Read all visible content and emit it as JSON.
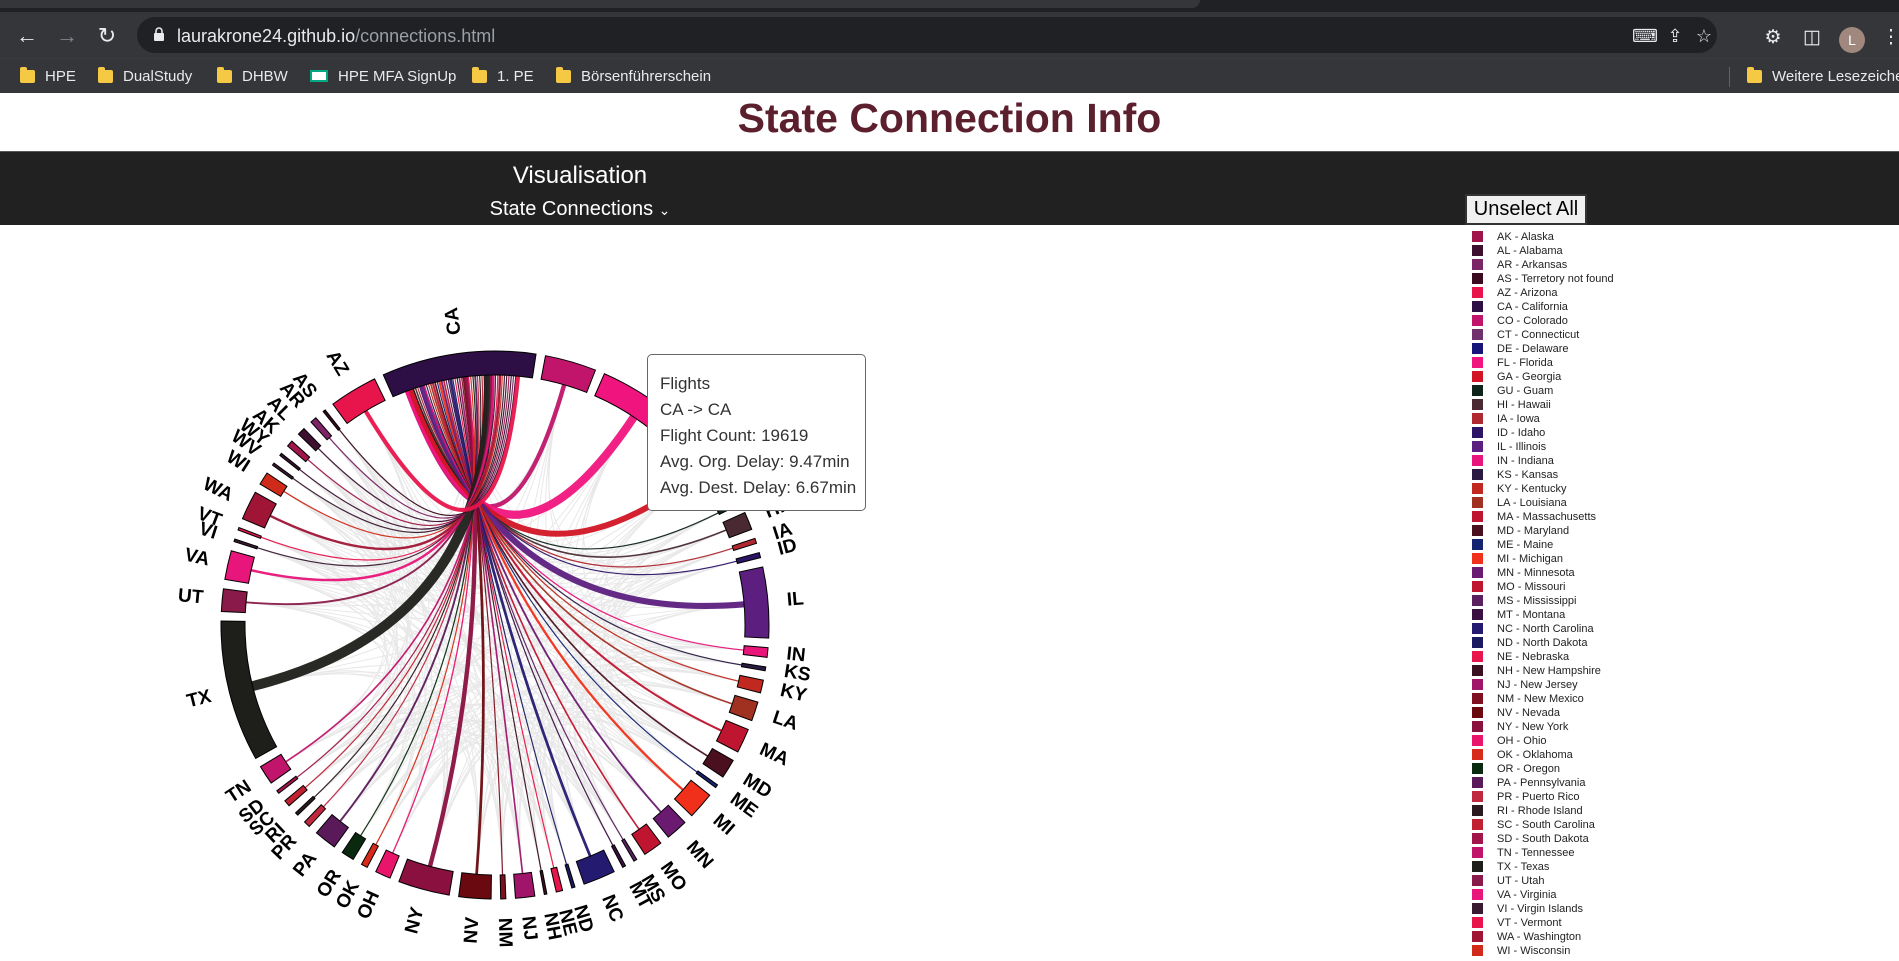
{
  "browser": {
    "url_host": "laurakrone24.github.io",
    "url_path": "/connections.html",
    "avatar_letter": "L",
    "bookmarks": [
      {
        "label": "HPE",
        "icon": "folder-icon"
      },
      {
        "label": "DualStudy",
        "icon": "folder-icon"
      },
      {
        "label": "DHBW",
        "icon": "folder-icon"
      },
      {
        "label": "HPE MFA SignUp",
        "icon": "hpe-icon"
      },
      {
        "label": "1. PE",
        "icon": "folder-icon"
      },
      {
        "label": "Börsenführerschein",
        "icon": "folder-icon"
      }
    ],
    "other_bookmarks": "Weitere Lesezeiche"
  },
  "page": {
    "title": "State Connection Info",
    "nav_title": "Visualisation",
    "nav_select": "State Connections",
    "unselect_all": "Unselect All"
  },
  "tooltip": {
    "title": "Flights",
    "route": "CA -> CA",
    "count": "Flight Count: 19619",
    "org_delay": "Avg. Org. Delay: 9.47min",
    "dest_delay": "Avg. Dest. Delay: 6.67min"
  },
  "legend": [
    {
      "label": "AK - Alaska",
      "color": "#a0154a"
    },
    {
      "label": "AL - Alabama",
      "color": "#3d1030"
    },
    {
      "label": "AR - Arkansas",
      "color": "#7b2466"
    },
    {
      "label": "AS - Terretory not found",
      "color": "#3a0a20"
    },
    {
      "label": "AZ - Arizona",
      "color": "#e8154c"
    },
    {
      "label": "CA - California",
      "color": "#2d0e45"
    },
    {
      "label": "CO - Colorado",
      "color": "#c0156a"
    },
    {
      "label": "CT - Connecticut",
      "color": "#70306c"
    },
    {
      "label": "DE - Delaware",
      "color": "#18157a"
    },
    {
      "label": "FL - Florida",
      "color": "#f0157e"
    },
    {
      "label": "GA - Georgia",
      "color": "#d11525"
    },
    {
      "label": "GU - Guam",
      "color": "#0f241a"
    },
    {
      "label": "HI - Hawaii",
      "color": "#4a2a32"
    },
    {
      "label": "IA - Iowa",
      "color": "#b02830"
    },
    {
      "label": "ID - Idaho",
      "color": "#2c1466"
    },
    {
      "label": "IL - Illinois",
      "color": "#5c1f80"
    },
    {
      "label": "IN - Indiana",
      "color": "#e8157a"
    },
    {
      "label": "KS - Kansas",
      "color": "#2a1a40"
    },
    {
      "label": "KY - Kentucky",
      "color": "#c02820"
    },
    {
      "label": "LA - Louisiana",
      "color": "#a03020"
    },
    {
      "label": "MA - Massachusetts",
      "color": "#c01530"
    },
    {
      "label": "MD - Maryland",
      "color": "#4a1020"
    },
    {
      "label": "ME - Maine",
      "color": "#142470"
    },
    {
      "label": "MI - Michigan",
      "color": "#f0301a"
    },
    {
      "label": "MN - Minnesota",
      "color": "#6a1a70"
    },
    {
      "label": "MO - Missouri",
      "color": "#c01530"
    },
    {
      "label": "MS - Mississippi",
      "color": "#5a2060"
    },
    {
      "label": "MT - Montana",
      "color": "#3a1040"
    },
    {
      "label": "NC - North Carolina",
      "color": "#241a70"
    },
    {
      "label": "ND - North Dakota",
      "color": "#1a1a60"
    },
    {
      "label": "NE - Nebraska",
      "color": "#e8154c"
    },
    {
      "label": "NH - New Hampshire",
      "color": "#3a1020"
    },
    {
      "label": "NJ - New Jersey",
      "color": "#a0156a"
    },
    {
      "label": "NM - New Mexico",
      "color": "#801020"
    },
    {
      "label": "NV - Nevada",
      "color": "#6a0a10"
    },
    {
      "label": "NY - New York",
      "color": "#8a1040"
    },
    {
      "label": "OH - Ohio",
      "color": "#e8156a"
    },
    {
      "label": "OK - Oklahoma",
      "color": "#d82a1a"
    },
    {
      "label": "OR - Oregon",
      "color": "#0a2a10"
    },
    {
      "label": "PA - Pennsylvania",
      "color": "#5a1a5a"
    },
    {
      "label": "PR - Puerto Rico",
      "color": "#c02840"
    },
    {
      "label": "RI - Rhode Island",
      "color": "#2a1a20"
    },
    {
      "label": "SC - South Carolina",
      "color": "#c02030"
    },
    {
      "label": "SD - South Dakota",
      "color": "#a0154a"
    },
    {
      "label": "TN - Tennessee",
      "color": "#c0156a"
    },
    {
      "label": "TX - Texas",
      "color": "#1e1f1a"
    },
    {
      "label": "UT - Utah",
      "color": "#8a1a4a"
    },
    {
      "label": "VA - Virginia",
      "color": "#e8157a"
    },
    {
      "label": "VI - Virgin Islands",
      "color": "#3a1a30"
    },
    {
      "label": "VT - Vermont",
      "color": "#e8154c"
    },
    {
      "label": "WA - Washington",
      "color": "#a01535"
    },
    {
      "label": "WI - Wisconsin",
      "color": "#d02a1a"
    }
  ],
  "chord": {
    "highlight_state": "CA",
    "states": [
      {
        "code": "CA",
        "label": "CA",
        "weight": 24,
        "color": "#2d0e45"
      },
      {
        "code": "CO",
        "label": "",
        "weight": 8,
        "color": "#c0156a"
      },
      {
        "code": "FL",
        "label": "FL",
        "weight": 15,
        "color": "#f0157e"
      },
      {
        "code": "GA",
        "label": "GA",
        "weight": 11,
        "color": "#d11525"
      },
      {
        "code": "GU",
        "label": "GU",
        "weight": 0.6,
        "color": "#0f241a"
      },
      {
        "code": "HI",
        "label": "HI",
        "weight": 2.8,
        "color": "#4a2a32"
      },
      {
        "code": "IA",
        "label": "IA",
        "weight": 0.8,
        "color": "#b02830"
      },
      {
        "code": "ID",
        "label": "ID",
        "weight": 0.8,
        "color": "#2c1466"
      },
      {
        "code": "IL",
        "label": "IL",
        "weight": 11,
        "color": "#5c1f80"
      },
      {
        "code": "IN",
        "label": "IN",
        "weight": 1.5,
        "color": "#e8157a"
      },
      {
        "code": "KS",
        "label": "KS",
        "weight": 0.6,
        "color": "#2a1a40"
      },
      {
        "code": "KY",
        "label": "KY",
        "weight": 2,
        "color": "#c02820"
      },
      {
        "code": "LA",
        "label": "LA",
        "weight": 3,
        "color": "#a03020"
      },
      {
        "code": "MA",
        "label": "MA",
        "weight": 3.8,
        "color": "#c01530"
      },
      {
        "code": "MD",
        "label": "MD",
        "weight": 3,
        "color": "#4a1020"
      },
      {
        "code": "ME",
        "label": "ME",
        "weight": 0.5,
        "color": "#142470"
      },
      {
        "code": "MI",
        "label": "MI",
        "weight": 4.2,
        "color": "#f0301a"
      },
      {
        "code": "MN",
        "label": "MN",
        "weight": 3.4,
        "color": "#6a1a70"
      },
      {
        "code": "MO",
        "label": "MO",
        "weight": 3,
        "color": "#c01530"
      },
      {
        "code": "MS",
        "label": "MS",
        "weight": 0.5,
        "color": "#5a2060"
      },
      {
        "code": "MT",
        "label": "MT",
        "weight": 0.5,
        "color": "#3a1040"
      },
      {
        "code": "NC",
        "label": "NC",
        "weight": 5,
        "color": "#241a70"
      },
      {
        "code": "ND",
        "label": "ND",
        "weight": 0.5,
        "color": "#1a1a60"
      },
      {
        "code": "NE",
        "label": "NE",
        "weight": 1,
        "color": "#e8154c"
      },
      {
        "code": "NH",
        "label": "NH",
        "weight": 0.4,
        "color": "#3a1020"
      },
      {
        "code": "NJ",
        "label": "NJ",
        "weight": 3,
        "color": "#a0156a"
      },
      {
        "code": "NM",
        "label": "NM",
        "weight": 0.8,
        "color": "#801020"
      },
      {
        "code": "NV",
        "label": "NV",
        "weight": 5,
        "color": "#6a0a10"
      },
      {
        "code": "NY",
        "label": "NY",
        "weight": 8,
        "color": "#8a1040"
      },
      {
        "code": "OH",
        "label": "OH",
        "weight": 2.4,
        "color": "#e8156a"
      },
      {
        "code": "OK",
        "label": "OK",
        "weight": 1,
        "color": "#d82a1a"
      },
      {
        "code": "OR",
        "label": "OR",
        "weight": 2,
        "color": "#0a2a10"
      },
      {
        "code": "PA",
        "label": "PA",
        "weight": 3.5,
        "color": "#5a1a5a"
      },
      {
        "code": "PR",
        "label": "PR",
        "weight": 1,
        "color": "#c02840"
      },
      {
        "code": "RI",
        "label": "RI",
        "weight": 0.5,
        "color": "#2a1a20"
      },
      {
        "code": "SC",
        "label": "SC",
        "weight": 1,
        "color": "#c02030"
      },
      {
        "code": "SD",
        "label": "SD",
        "weight": 0.5,
        "color": "#a0154a"
      },
      {
        "code": "TN",
        "label": "TN",
        "weight": 3,
        "color": "#c0156a"
      },
      {
        "code": "TX",
        "label": "TX",
        "weight": 22,
        "color": "#1e1f1a"
      },
      {
        "code": "UT",
        "label": "UT",
        "weight": 3.5,
        "color": "#8a1a4a"
      },
      {
        "code": "VA",
        "label": "VA",
        "weight": 4.5,
        "color": "#e8157a"
      },
      {
        "code": "VI",
        "label": "VI",
        "weight": 0.4,
        "color": "#3a1a30"
      },
      {
        "code": "VT",
        "label": "VT",
        "weight": 0.4,
        "color": "#e8154c"
      },
      {
        "code": "WA",
        "label": "WA",
        "weight": 4.5,
        "color": "#a01535"
      },
      {
        "code": "WI",
        "label": "WI",
        "weight": 2,
        "color": "#d02a1a"
      },
      {
        "code": "WV",
        "label": "WV",
        "weight": 0.4,
        "color": "#3a1a30"
      },
      {
        "code": "WY",
        "label": "WY",
        "weight": 0.4,
        "color": "#3a1030"
      },
      {
        "code": "AK",
        "label": "AK",
        "weight": 1,
        "color": "#a0154a"
      },
      {
        "code": "AL",
        "label": "AL",
        "weight": 1.2,
        "color": "#3d1030"
      },
      {
        "code": "AR",
        "label": "AR",
        "weight": 1,
        "color": "#7b2466"
      },
      {
        "code": "AS",
        "label": "AS",
        "weight": 0.4,
        "color": "#3a0a20"
      },
      {
        "code": "AZ",
        "label": "AZ",
        "weight": 7.5,
        "color": "#e8154c"
      }
    ]
  }
}
